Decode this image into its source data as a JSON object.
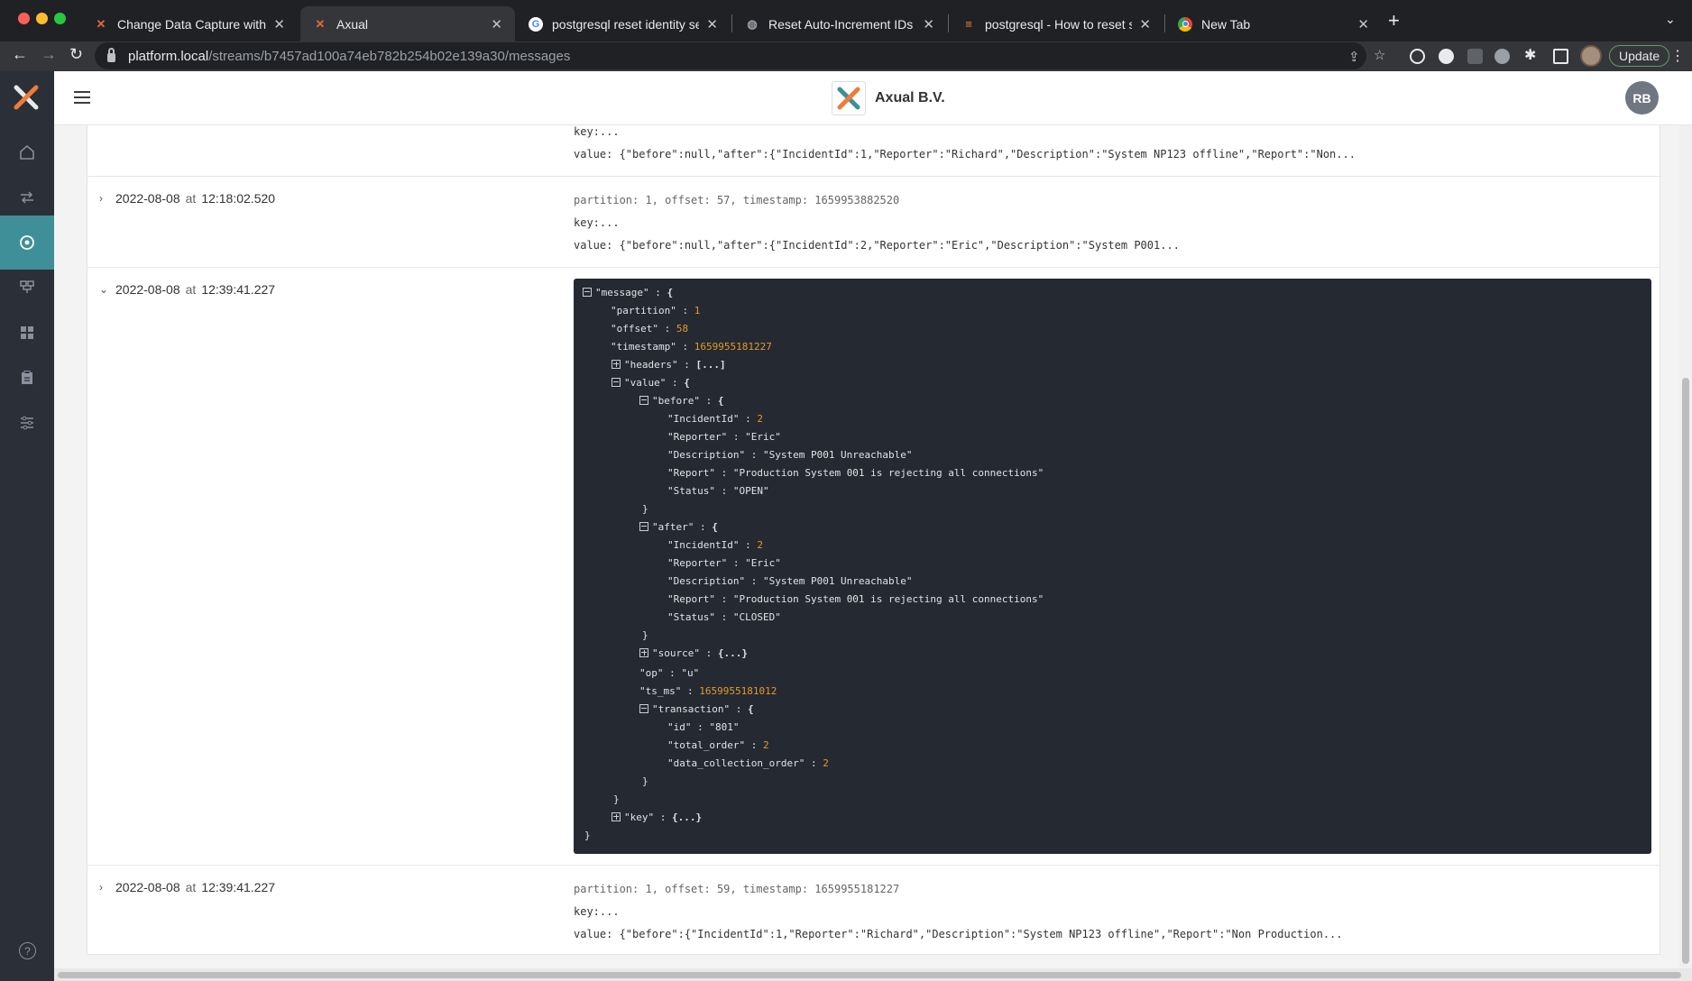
{
  "browser": {
    "tabs": [
      {
        "title": "Change Data Capture with Pos",
        "icon": "axual-x-icon"
      },
      {
        "title": "Axual",
        "icon": "axual-x-icon"
      },
      {
        "title": "postgresql reset identity seque",
        "icon": "google-g-icon"
      },
      {
        "title": "Reset Auto-Increment IDs in Po",
        "icon": "globe-icon"
      },
      {
        "title": "postgresql - How to reset seq",
        "icon": "stackoverflow-icon"
      },
      {
        "title": "New Tab",
        "icon": "chrome-icon"
      }
    ],
    "url_host": "platform.local",
    "url_path": "/streams/b7457ad100a74eb782b254b02e139a30/messages",
    "update_label": "Update",
    "colors": {
      "chrome_dark": "#202124",
      "chrome_mid": "#35363a"
    }
  },
  "app": {
    "brand_name": "Axual B.V.",
    "avatar_initials": "RB",
    "sidebar_items": [
      "home-icon",
      "streams-icon",
      "stream-browse-icon",
      "applications-icon",
      "dashboard-icon",
      "clipboard-icon",
      "settings-sliders-icon"
    ],
    "accent": "#3f8f99",
    "json_number_color": "#e39a2b"
  },
  "messages": {
    "top_partial": {
      "key": "key:...",
      "value": "value: {\"before\":null,\"after\":{\"IncidentId\":1,\"Reporter\":\"Richard\",\"Description\":\"System NP123 offline\",\"Report\":\"Non..."
    },
    "row1": {
      "date": "2022-08-08",
      "at": "at",
      "time": "12:18:02.520",
      "meta": "partition: 1, offset: 57, timestamp: 1659953882520",
      "key": "key:...",
      "value": "value: {\"before\":null,\"after\":{\"IncidentId\":2,\"Reporter\":\"Eric\",\"Description\":\"System P001..."
    },
    "row2": {
      "date": "2022-08-08",
      "at": "at",
      "time": "12:39:41.227"
    },
    "row3": {
      "date": "2022-08-08",
      "at": "at",
      "time": "12:39:41.227",
      "meta": "partition: 1, offset: 59, timestamp: 1659955181227",
      "key": "key:...",
      "value": "value: {\"before\":{\"IncidentId\":1,\"Reporter\":\"Richard\",\"Description\":\"System NP123 offline\",\"Report\":\"Non Production..."
    }
  },
  "json": {
    "message_key": "\"message\"",
    "partition_key": "\"partition\"",
    "partition": "1",
    "offset_key": "\"offset\"",
    "offset": "58",
    "timestamp_key": "\"timestamp\"",
    "timestamp": "1659955181227",
    "headers_key": "\"headers\"",
    "collapsed_array": "[...]",
    "value_key": "\"value\"",
    "before_key": "\"before\"",
    "before": {
      "incidentid_key": "\"IncidentId\"",
      "incidentid": "2",
      "reporter_key": "\"Reporter\"",
      "reporter": "\"Eric\"",
      "description_key": "\"Description\"",
      "description": "\"System P001 Unreachable\"",
      "report_key": "\"Report\"",
      "report": "\"Production System 001 is rejecting all connections\"",
      "status_key": "\"Status\"",
      "status": "\"OPEN\""
    },
    "after_key": "\"after\"",
    "after": {
      "incidentid_key": "\"IncidentId\"",
      "incidentid": "2",
      "reporter_key": "\"Reporter\"",
      "reporter": "\"Eric\"",
      "description_key": "\"Description\"",
      "description": "\"System P001 Unreachable\"",
      "report_key": "\"Report\"",
      "report": "\"Production System 001 is rejecting all connections\"",
      "status_key": "\"Status\"",
      "status": "\"CLOSED\""
    },
    "source_key": "\"source\"",
    "collapsed_object": "{...}",
    "op_key": "\"op\"",
    "op": "\"u\"",
    "ts_ms_key": "\"ts_ms\"",
    "ts_ms": "1659955181012",
    "transaction_key": "\"transaction\"",
    "transaction": {
      "id_key": "\"id\"",
      "id": "\"801\"",
      "total_order_key": "\"total_order\"",
      "total_order": "2",
      "dco_key": "\"data_collection_order\"",
      "dco": "2"
    },
    "key_key": "\"key\""
  }
}
